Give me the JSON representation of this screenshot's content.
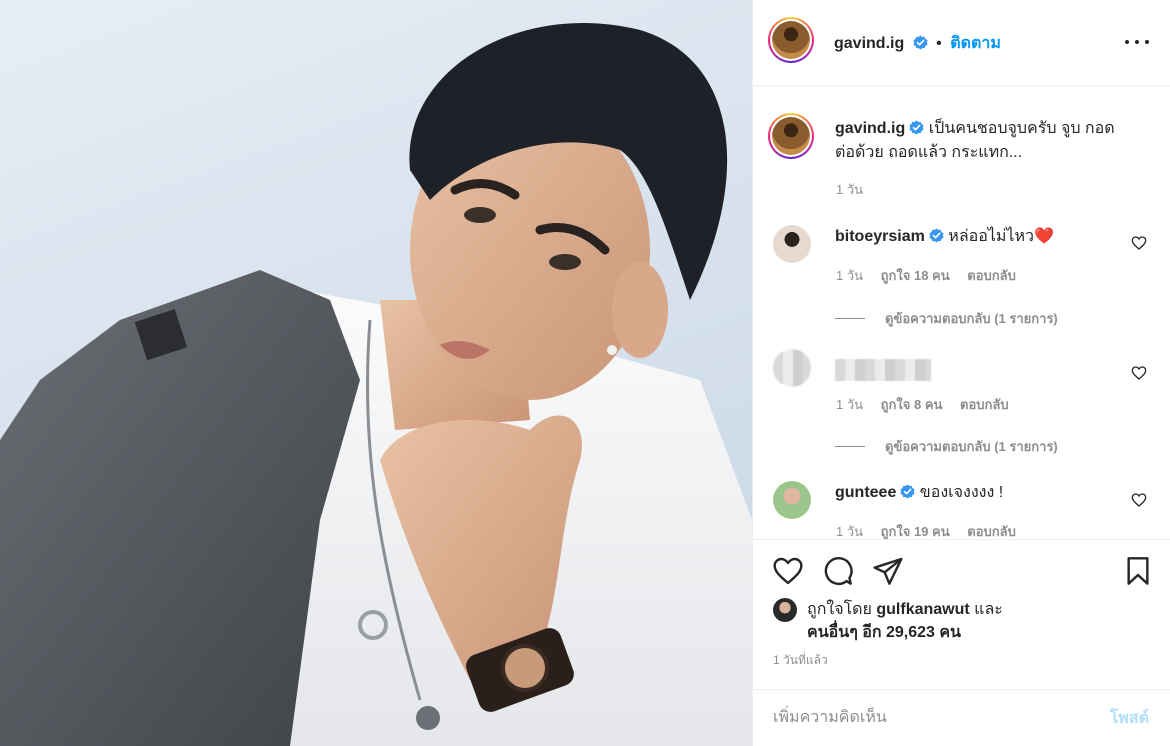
{
  "post_author": {
    "username": "gavind.ig",
    "follow_label": "ติดตาม",
    "separator": "•"
  },
  "caption": {
    "username": "gavind.ig",
    "text": "เป็นคนชอบจูบครับ จูบ กอด ต่อด้วย ถอดแล้ว กระแทก...",
    "time": "1 วัน"
  },
  "comments": [
    {
      "username": "bitoeyrsiam",
      "text": "หล่ออไม่ไหว",
      "emoji": "❤️",
      "time": "1 วัน",
      "likes": "ถูกใจ 18 คน",
      "reply_label": "ตอบกลับ",
      "view_replies": "ดูข้อความตอบกลับ (1 รายการ)"
    },
    {
      "username": "",
      "text": "",
      "time": "1 วัน",
      "likes": "ถูกใจ 8 คน",
      "reply_label": "ตอบกลับ",
      "view_replies": "ดูข้อความตอบกลับ (1 รายการ)"
    },
    {
      "username": "gunteee",
      "text": "ของเจงงงง !",
      "time": "1 วัน",
      "likes": "ถูกใจ 19 คน",
      "reply_label": "ตอบกลับ"
    }
  ],
  "liked_by": {
    "prefix": "ถูกใจโดย",
    "user": "gulfkanawut",
    "conjunction": "และ",
    "others": "คนอื่นๆ อีก 29,623 คน"
  },
  "post_time": "1 วันที่แล้ว",
  "comment_box": {
    "placeholder": "เพิ่มความคิดเห็น",
    "post_label": "โพสต์"
  },
  "icons": {
    "like": "heart-icon",
    "comment": "comment-icon",
    "share": "paper-plane-icon",
    "save": "bookmark-icon",
    "more": "more-options-icon",
    "verified": "verified-badge-icon"
  },
  "colors": {
    "accent": "#0095f6",
    "post_disabled": "#b2dffc",
    "verified": "#3897f0",
    "heart_emoji": "#e0245e",
    "meta": "#8e8e8e"
  }
}
